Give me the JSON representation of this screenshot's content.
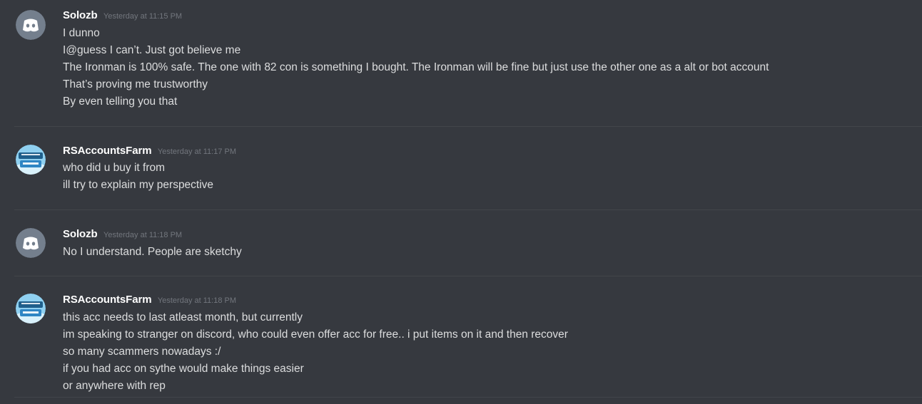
{
  "colors": {
    "background": "#36393f",
    "username": "#ffffff",
    "timestamp": "#72767d",
    "message_text": "#dcddde",
    "discord_avatar_bg": "#747f8d",
    "farm_avatar_sky": "#8fd0f0",
    "divider": "#42454a"
  },
  "messages": [
    {
      "author": "Solozb",
      "timestamp": "Yesterday at 11:15 PM",
      "avatar_icon": "discord-logo-icon",
      "lines": [
        "I dunno",
        "I@guess I can’t. Just got believe me",
        "The Ironman is 100% safe. The one with 82 con is something I bought. The Ironman will be fine but just use the other one as a alt or bot account",
        "That’s proving me trustworthy",
        "By even telling you that"
      ]
    },
    {
      "author": "RSAccountsFarm",
      "timestamp": "Yesterday at 11:17 PM",
      "avatar_icon": "rsaccountsfarm-logo-icon",
      "lines": [
        "who did u buy it from",
        "ill try to explain my perspective"
      ]
    },
    {
      "author": "Solozb",
      "timestamp": "Yesterday at 11:18 PM",
      "avatar_icon": "discord-logo-icon",
      "lines": [
        "No I understand. People are sketchy"
      ]
    },
    {
      "author": "RSAccountsFarm",
      "timestamp": "Yesterday at 11:18 PM",
      "avatar_icon": "rsaccountsfarm-logo-icon",
      "lines": [
        "this acc needs to last atleast month, but currently",
        "im speaking to stranger on discord, who could even offer acc for free.. i put items on it and then recover",
        "so many scammers nowadays :/",
        "if you had acc on sythe would make things easier",
        "or anywhere with rep"
      ]
    }
  ]
}
